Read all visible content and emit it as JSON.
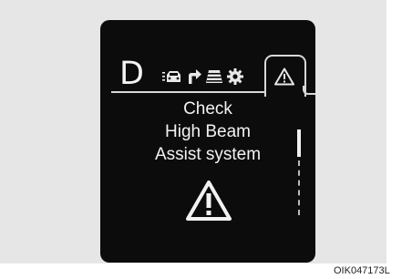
{
  "display": {
    "gear": "D",
    "tabs": [
      {
        "icon": "vehicle-distance-icon",
        "active": false
      },
      {
        "icon": "turn-arrow-icon",
        "active": false
      },
      {
        "icon": "lane-road-icon",
        "active": false
      },
      {
        "icon": "settings-gear-icon",
        "active": false
      },
      {
        "icon": "warning-triangle-icon",
        "active": true
      }
    ],
    "message": {
      "line1": "Check",
      "line2": "High Beam",
      "line3": "Assist system"
    },
    "warning_icon": "warning-triangle-icon"
  },
  "caption": "OIK047173L"
}
